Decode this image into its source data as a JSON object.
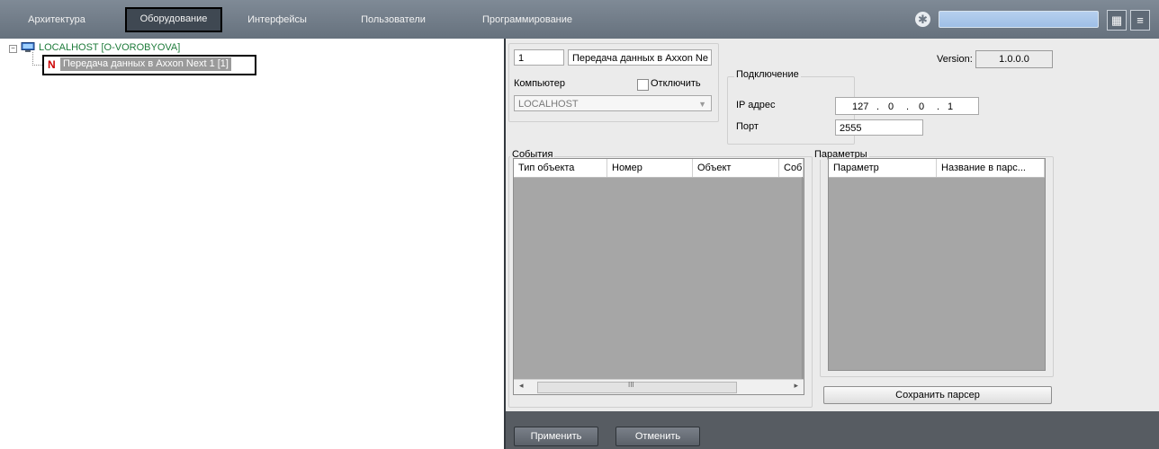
{
  "menu": {
    "items": [
      {
        "label": "Архитектура"
      },
      {
        "label": "Оборудование"
      },
      {
        "label": "Интерфейсы"
      },
      {
        "label": "Пользователи"
      },
      {
        "label": "Программирование"
      }
    ],
    "active": "Оборудование",
    "search_value": ""
  },
  "tree": {
    "root_label": "LOCALHOST [O-VOROBYOVA]",
    "child_icon": "N",
    "child_label": "Передача данных в Axxon Next 1 [1]"
  },
  "panel": {
    "id_value": "1",
    "name_value": "Передача данных в Axxon Ne",
    "version_label": "Version:",
    "version_value": "1.0.0.0",
    "computer_label": "Компьютер",
    "disable_label": "Отключить",
    "computer_value": "LOCALHOST",
    "connection_title": "Подключение",
    "ip_label": "IP адрес",
    "ip_parts": [
      "127",
      "0",
      "0",
      "1"
    ],
    "port_label": "Порт",
    "port_value": "2555",
    "events_title": "События",
    "events_columns": [
      "Тип объекта",
      "Номер",
      "Объект",
      "Соб"
    ],
    "params_title": "Параметры",
    "params_columns": [
      "Параметр",
      "Название в парс..."
    ],
    "scroll_mark": "III",
    "save_parser_label": "Сохранить парсер"
  },
  "footer": {
    "apply_label": "Применить",
    "cancel_label": "Отменить"
  },
  "colors": {
    "topbar": "#6e7985",
    "tree_root_text": "#1e7b3a",
    "panel_bg": "#ebebeb",
    "bottom_bar": "#575c62"
  }
}
